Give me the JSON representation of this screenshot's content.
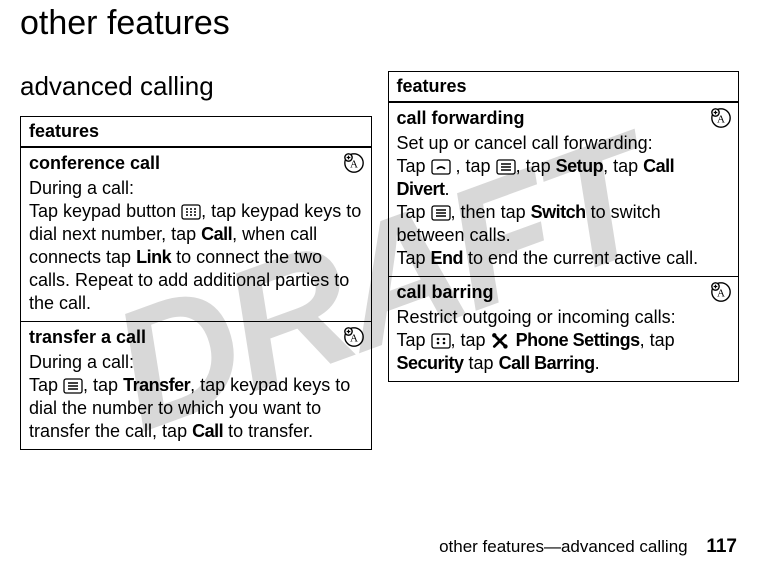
{
  "watermark": "DRAFT",
  "page_title": "other features",
  "section_heading": "advanced calling",
  "left_table": {
    "header": "features",
    "rows": [
      {
        "title": "conference call",
        "line1": "During a call:",
        "text_a": "Tap keypad button ",
        "text_b": ", tap keypad keys to dial next number, tap ",
        "bold_b": "Call",
        "text_c": ", when call connects tap ",
        "bold_c": "Link",
        "text_d": " to connect the two calls. Repeat to add additional parties to the call."
      },
      {
        "title": "transfer a call",
        "line1": "During a call:",
        "text_a": "Tap ",
        "text_b": ", tap ",
        "bold_b": "Transfer",
        "text_c": ", tap keypad keys to dial the number to which you want to transfer the call, tap ",
        "bold_c": "Call",
        "text_d": " to transfer."
      }
    ]
  },
  "right_table": {
    "header": "features",
    "rows": [
      {
        "title": "call forwarding",
        "line1": "Set up or cancel call forwarding:",
        "p1_a": "Tap ",
        "p1_b": " , tap ",
        "p1_c": ", tap ",
        "p1_bold1": "Setup",
        "p1_d": ", tap ",
        "p1_bold2": "Call Divert",
        "p1_e": ".",
        "p2_a": "Tap ",
        "p2_b": ", then tap ",
        "p2_bold": "Switch",
        "p2_c": " to switch between calls.",
        "p3_a": "Tap ",
        "p3_bold": "End",
        "p3_b": " to end the current active call."
      },
      {
        "title": "call barring",
        "line1": "Restrict outgoing or incoming calls:",
        "p1_a": "Tap ",
        "p1_b": ", tap ",
        "p1_bold1": "Phone Settings",
        "p1_c": ", tap ",
        "p1_bold2": "Security",
        "p1_d": " tap ",
        "p1_bold3": "Call Barring",
        "p1_e": "."
      }
    ]
  },
  "footer_text": "other features—advanced calling",
  "page_number": "117"
}
